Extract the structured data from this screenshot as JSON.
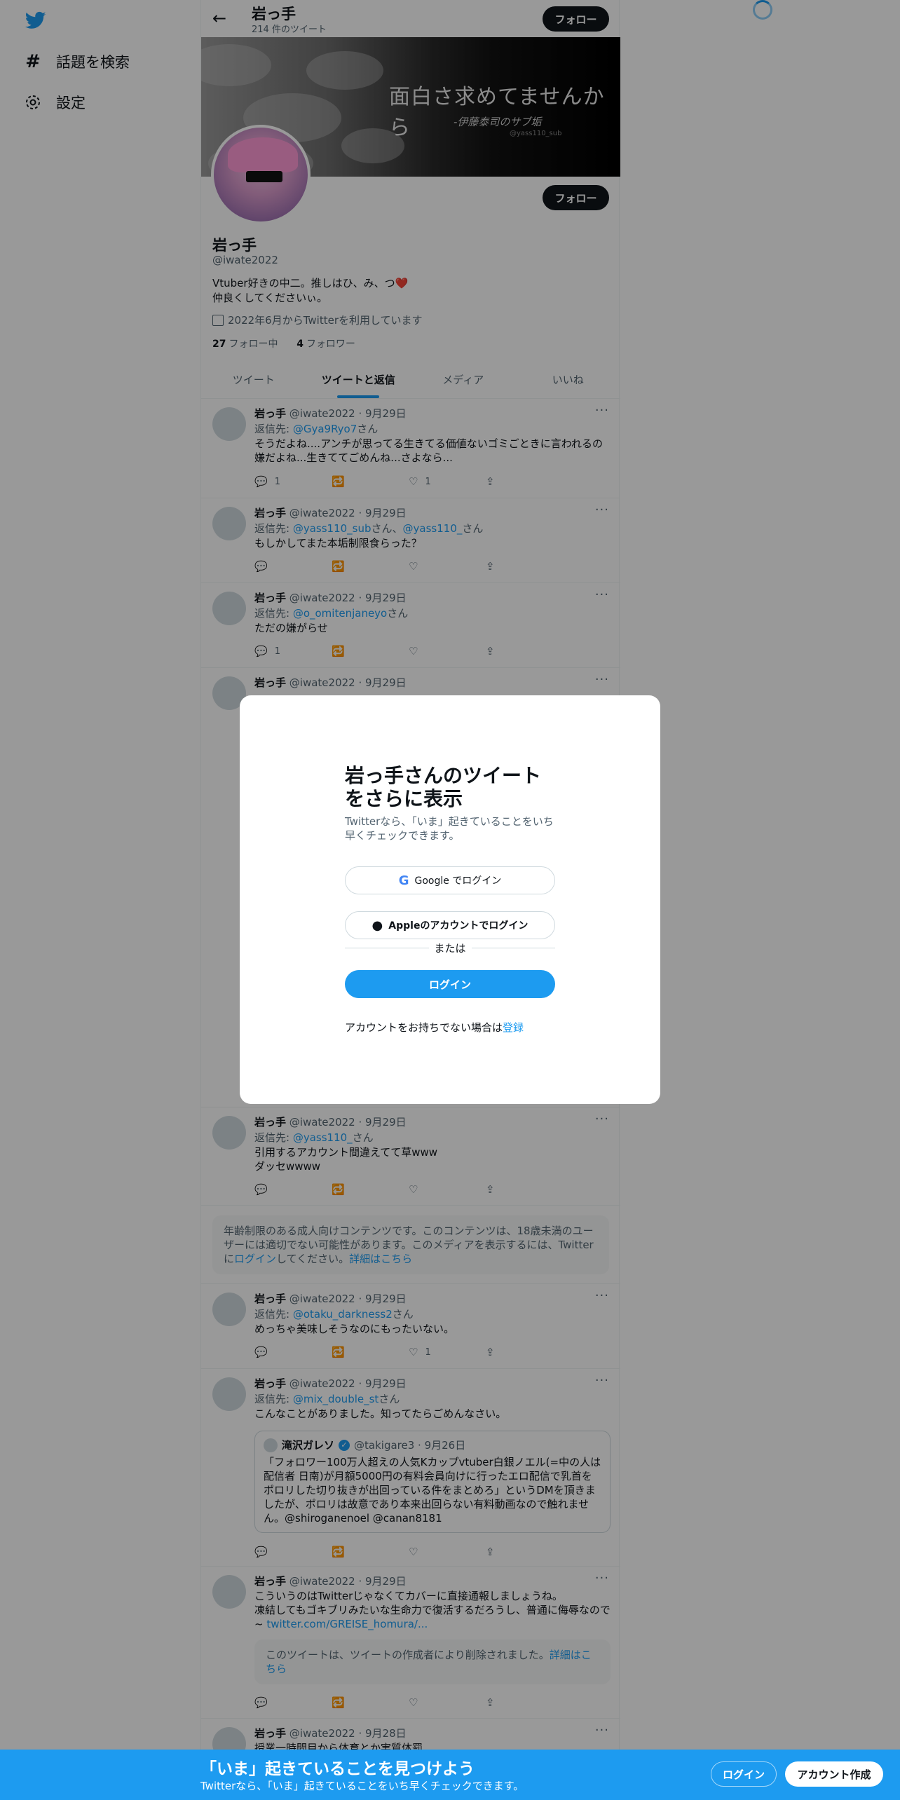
{
  "nav": {
    "explore_label": "話題を検索",
    "settings_label": "設定"
  },
  "header": {
    "name": "岩っ手",
    "tweet_count": "214 件のツイート",
    "follow_label": "フォロー"
  },
  "banner": {
    "title": "面白さ求めてませんから",
    "subtitle": "-伊藤泰司のサブ垢",
    "small_handle": "@yass110_sub"
  },
  "profile": {
    "name": "岩っ手",
    "handle": "@iwate2022",
    "bio_line1": "Vtuber好きの中二。推しはひ、み、つ❤️",
    "bio_line2": "仲良くしてくださいぃ。",
    "joined": "2022年6月からTwitterを利用しています",
    "following_count": "27",
    "following_label": "フォロー中",
    "followers_count": "4",
    "followers_label": "フォロワー",
    "follow_label": "フォロー"
  },
  "tabs": [
    "ツイート",
    "ツイートと返信",
    "メディア",
    "いいね"
  ],
  "tweets": [
    {
      "name": "岩っ手",
      "meta": "@iwate2022 · 9月29日",
      "reply_prefix": "返信先: ",
      "reply_to": "@Gya9Ryo7",
      "reply_suffix": "さん",
      "text": "そうだよね....アンチが思ってる生きてる価値ないゴミごときに言われるの嫌だよね...生きててごめんね...さよなら...",
      "replies": "1",
      "retweets": "",
      "likes": "1"
    },
    {
      "name": "岩っ手",
      "meta": "@iwate2022 · 9月29日",
      "reply_prefix": "返信先: ",
      "reply_to": "@yass110_sub",
      "reply_mid": "さん、",
      "reply_to2": "@yass110_",
      "reply_suffix": "さん",
      "text": "もしかしてまた本垢制限食らった？",
      "replies": "",
      "retweets": "",
      "likes": ""
    },
    {
      "name": "岩っ手",
      "meta": "@iwate2022 · 9月29日",
      "reply_prefix": "返信先: ",
      "reply_to": "@o_omitenjaneyo",
      "reply_suffix": "さん",
      "text": "ただの嫌がらせ",
      "replies": "1",
      "retweets": "",
      "likes": ""
    },
    {
      "name": "岩っ手",
      "meta": "@iwate2022 · 9月29日"
    },
    {
      "name": "岩っ手",
      "meta": "@iwate2022 · 9月29日",
      "reply_prefix": "返信先: ",
      "reply_to": "@yass110_",
      "reply_suffix": "さん",
      "text_line1": "引用するアカウント間違えてて草www",
      "text_line2": "ダッセwwww",
      "replies": "",
      "retweets": "",
      "likes": ""
    },
    {
      "name": "岩っ手",
      "meta": "@iwate2022 · 9月29日",
      "reply_prefix": "返信先: ",
      "reply_to": "@otaku_darkness2",
      "reply_suffix": "さん",
      "text": "めっちゃ美味しそうなのにもったいない。",
      "replies": "",
      "retweets": "",
      "likes": "1"
    },
    {
      "name": "岩っ手",
      "meta": "@iwate2022 · 9月29日",
      "reply_prefix": "返信先: ",
      "reply_to": "@mix_double_st",
      "reply_suffix": "さん",
      "text": "こんなことがありました。知ってたらごめんなさい。",
      "replies": "",
      "retweets": "",
      "likes": ""
    },
    {
      "name": "岩っ手",
      "meta": "@iwate2022 · 9月29日",
      "text_line1": "こういうのはTwitterじゃなくてカバーに直接通報しましょうね。",
      "text_line2": "凍結してもゴキブリみたいな生命力で復活するだろうし、普通に侮辱なので~",
      "link": "twitter.com/GREISE_homura/...",
      "replies": "",
      "retweets": "",
      "likes": ""
    },
    {
      "name": "岩っ手",
      "meta": "@iwate2022 · 9月28日",
      "text": "授業一時間目から体育とか実質体罰"
    }
  ],
  "age_notice": {
    "text1": "年齢制限のある成人向けコンテンツです。このコンテンツは、18歳未満のユーザーには適切でない可能性があります。このメディアを表示するには、Twitterに",
    "link1": "ログイン",
    "text2": "してください。",
    "link2": "詳細はこちら"
  },
  "quote": {
    "name": "滝沢ガレソ",
    "meta": "@takigare3 · 9月26日",
    "text": "「フォロワー100万人超えの人気Kカップvtuber白銀ノエル(=中の人は配信者 日南)が月額5000円の有料会員向けに行ったエロ配信で乳首をポロリした切り抜きが出回っている件をまとめろ」というDMを頂きましたが、ポロリは故意であり本来出回らない有料動画なので触れません。@shiroganenoel @canan8181"
  },
  "deleted_notice": {
    "text": "このツイートは、ツイートの作成者により削除されました。",
    "link": "詳細はこちら"
  },
  "modal": {
    "title": "岩っ手さんのツイートをさらに表示",
    "subtitle": "Twitterなら、「いま」起きていることをいち早くチェックできます。",
    "google_label": "Google でログイン",
    "apple_label": "Appleのアカウントでログイン",
    "or_label": "または",
    "login_label": "ログイン",
    "signup_prefix": "アカウントをお持ちでない場合は",
    "signup_link": "登録"
  },
  "bottom_bar": {
    "title": "「いま」起きていることを見つけよう",
    "subtitle": "Twitterなら、「いま」起きていることをいち早くチェックできます。",
    "login_label": "ログイン",
    "signup_label": "アカウント作成"
  }
}
